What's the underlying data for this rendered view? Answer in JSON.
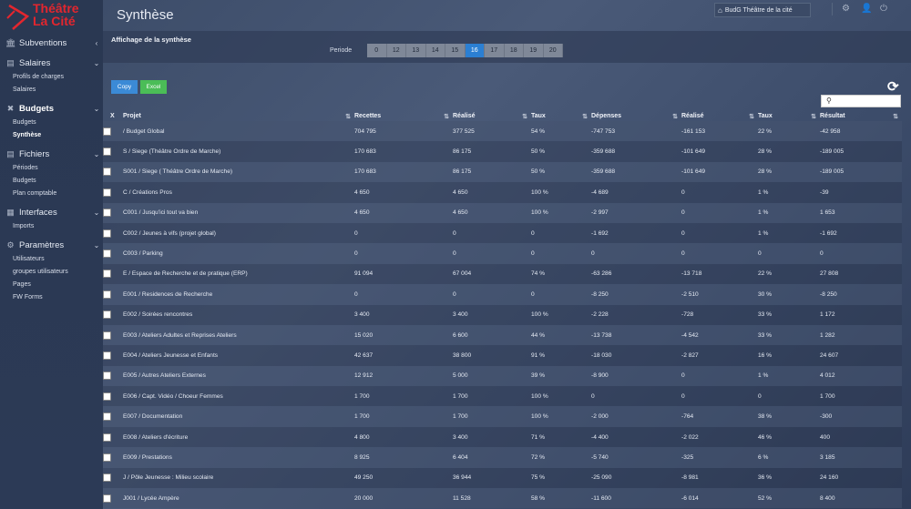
{
  "brand": {
    "logo_line1": "Théâtre",
    "logo_line2": "La Cité",
    "logo_sub": ""
  },
  "sidebar": {
    "sections": [
      {
        "label": "Subventions",
        "icon": "bank-icon",
        "chevron": "‹",
        "items": []
      },
      {
        "label": "Salaires",
        "icon": "document-icon",
        "chevron": "⌄",
        "items": [
          {
            "label": "Profils de charges"
          },
          {
            "label": "Salaires"
          }
        ]
      },
      {
        "label": "Budgets",
        "icon": "tools-icon",
        "chevron": "⌄",
        "active": true,
        "items": [
          {
            "label": "Budgets"
          },
          {
            "label": "Synthèse",
            "active": true
          }
        ]
      },
      {
        "label": "Fichiers",
        "icon": "file-icon",
        "chevron": "⌄",
        "items": [
          {
            "label": "Périodes"
          },
          {
            "label": "Budgets"
          },
          {
            "label": "Plan comptable"
          }
        ]
      },
      {
        "label": "Interfaces",
        "icon": "grid-icon",
        "chevron": "⌄",
        "items": [
          {
            "label": "Imports"
          }
        ]
      },
      {
        "label": "Paramètres",
        "icon": "gear-icon",
        "chevron": "⌄",
        "items": [
          {
            "label": "Utilisateurs"
          },
          {
            "label": "groupes utilisateurs"
          },
          {
            "label": "Pages"
          },
          {
            "label": "FW Forms"
          }
        ]
      }
    ]
  },
  "header": {
    "title": "Synthèse",
    "site_select": "BudG Théâtre de la cité"
  },
  "filter": {
    "title": "Affichage de la synthèse",
    "period_label": "Periode",
    "periods": [
      "0",
      "12",
      "13",
      "14",
      "15",
      "16",
      "17",
      "18",
      "19",
      "20"
    ],
    "active_period": "16"
  },
  "toolbar": {
    "copy_label": "Copy",
    "excel_label": "Excel",
    "search_placeholder": ""
  },
  "table": {
    "headers": {
      "x": "X",
      "projet": "Projet",
      "recettes": "Recettes",
      "realise": "Réalisé",
      "taux": "Taux",
      "depenses": "Dépenses",
      "realise2": "Réalisé",
      "taux2": "Taux",
      "resultat": "Résultat"
    },
    "rows": [
      [
        "/ Budget Global",
        "704 795",
        "377 525",
        "54 %",
        "-747 753",
        "-161 153",
        "22 %",
        "-42 958"
      ],
      [
        "S / Siege (Théâtre Ordre de Marche)",
        "170 683",
        "86 175",
        "50 %",
        "-359 688",
        "-101 649",
        "28 %",
        "-189 005"
      ],
      [
        "S001 / Siege ( Théâtre Ordre de Marche)",
        "170 683",
        "86 175",
        "50 %",
        "-359 688",
        "-101 649",
        "28 %",
        "-189 005"
      ],
      [
        "C / Créations Pros",
        "4 650",
        "4 650",
        "100 %",
        "-4 689",
        "0",
        "1 %",
        "-39"
      ],
      [
        "C001 / Jusqu'ici tout va bien",
        "4 650",
        "4 650",
        "100 %",
        "-2 997",
        "0",
        "1 %",
        "1 653"
      ],
      [
        "C002 / Jeunes à vifs (projet global)",
        "0",
        "0",
        "0",
        "-1 692",
        "0",
        "1 %",
        "-1 692"
      ],
      [
        "C003 / Parking",
        "0",
        "0",
        "0",
        "0",
        "0",
        "0",
        "0"
      ],
      [
        "E / Espace de Recherche et de pratique (ERP)",
        "91 094",
        "67 004",
        "74 %",
        "-63 286",
        "-13 718",
        "22 %",
        "27 808"
      ],
      [
        "E001 / Residences de Recherche",
        "0",
        "0",
        "0",
        "-8 250",
        "-2 510",
        "30 %",
        "-8 250"
      ],
      [
        "E002 / Soirées rencontres",
        "3 400",
        "3 400",
        "100 %",
        "-2 228",
        "-728",
        "33 %",
        "1 172"
      ],
      [
        "E003 / Ateliers Adultes et Reprises Ateliers",
        "15 020",
        "6 600",
        "44 %",
        "-13 738",
        "-4 542",
        "33 %",
        "1 282"
      ],
      [
        "E004 / Ateliers Jeunesse et Enfants",
        "42 637",
        "38 800",
        "91 %",
        "-18 030",
        "-2 827",
        "16 %",
        "24 607"
      ],
      [
        "E005 / Autres Ateliers Externes",
        "12 912",
        "5 000",
        "39 %",
        "-8 900",
        "0",
        "1 %",
        "4 012"
      ],
      [
        "E006 / Capt. Vidéo / Choeur Femmes",
        "1 700",
        "1 700",
        "100 %",
        "0",
        "0",
        "0",
        "1 700"
      ],
      [
        "E007 / Documentation",
        "1 700",
        "1 700",
        "100 %",
        "-2 000",
        "-764",
        "38 %",
        "-300"
      ],
      [
        "E008 / Ateliers d'écriture",
        "4 800",
        "3 400",
        "71 %",
        "-4 400",
        "-2 022",
        "46 %",
        "400"
      ],
      [
        "E009 / Prestations",
        "8 925",
        "6 404",
        "72 %",
        "-5 740",
        "-325",
        "6 %",
        "3 185"
      ],
      [
        "J / Pôle Jeunesse : Milieu scolaire",
        "49 250",
        "36 944",
        "75 %",
        "-25 090",
        "-8 981",
        "36 %",
        "24 160"
      ],
      [
        "J001 / Lycée Ampère",
        "20 000",
        "11 528",
        "58 %",
        "-11 600",
        "-6 014",
        "52 %",
        "8 400"
      ]
    ]
  }
}
